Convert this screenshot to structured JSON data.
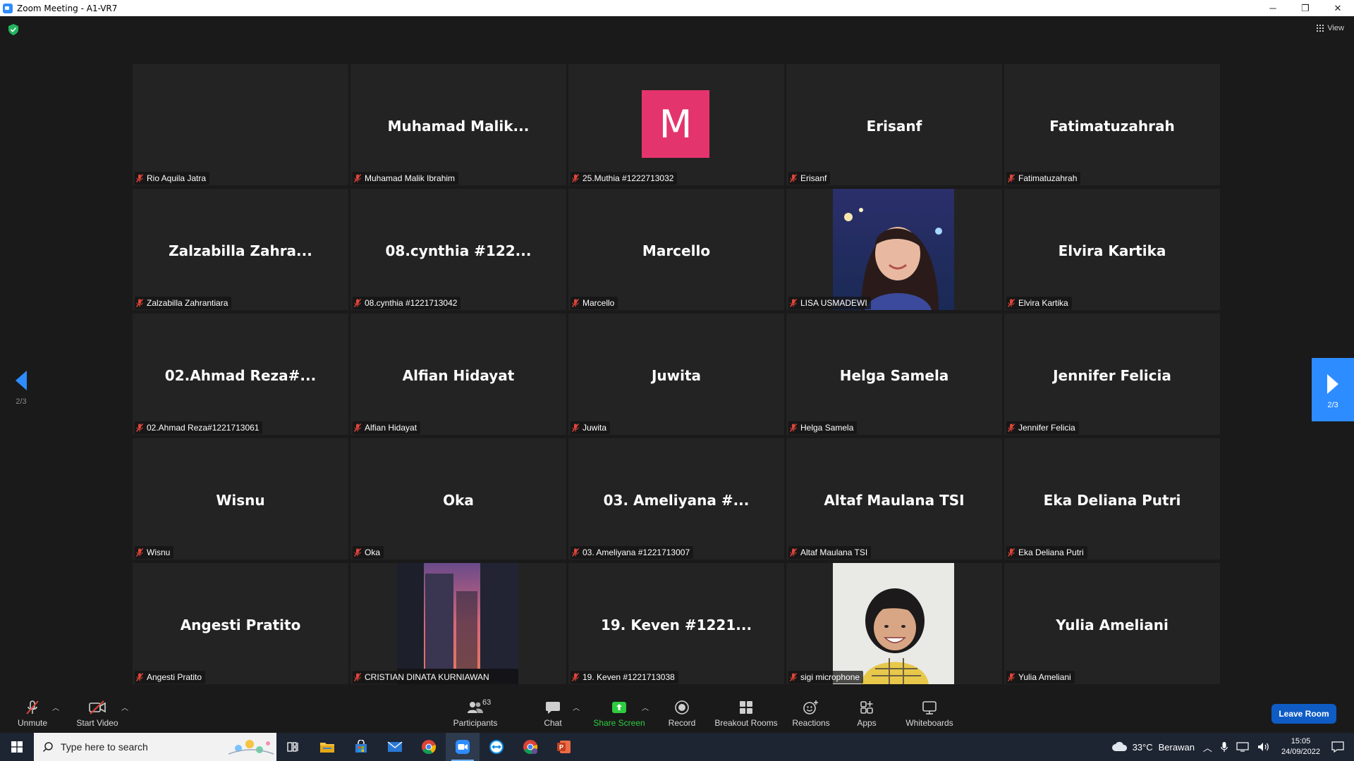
{
  "window": {
    "title": "Zoom Meeting - A1-VR7",
    "minimize": "─",
    "maximize": "❐",
    "close": "✕"
  },
  "top": {
    "view_label": "View"
  },
  "pager": {
    "left_page": "2/3",
    "right_page": "2/3"
  },
  "tiles": [
    {
      "big": "",
      "label": "Rio Aquila Jatra"
    },
    {
      "big": "Muhamad  Malik...",
      "label": "Muhamad Malik Ibrahim"
    },
    {
      "big": "",
      "label": "25.Muthia #1222713032",
      "avatar": "M"
    },
    {
      "big": "Erisanf",
      "label": "Erisanf"
    },
    {
      "big": "Fatimatuzahrah",
      "label": "Fatimatuzahrah"
    },
    {
      "big": "Zalzabilla  Zahra...",
      "label": "Zalzabilla Zahrantiara"
    },
    {
      "big": "08.cynthia #122...",
      "label": "08.cynthia #1221713042"
    },
    {
      "big": "Marcello",
      "label": "Marcello"
    },
    {
      "big": "",
      "label": "LISA USMADEWI"
    },
    {
      "big": "Elvira Kartika",
      "label": "Elvira Kartika"
    },
    {
      "big": "02.Ahmad  Reza#...",
      "label": "02.Ahmad Reza#1221713061"
    },
    {
      "big": "Alfian Hidayat",
      "label": "Alfian Hidayat"
    },
    {
      "big": "Juwita",
      "label": "Juwita"
    },
    {
      "big": "Helga Samela",
      "label": "Helga Samela"
    },
    {
      "big": "Jennifer Felicia",
      "label": "Jennifer Felicia"
    },
    {
      "big": "Wisnu",
      "label": "Wisnu"
    },
    {
      "big": "Oka",
      "label": "Oka"
    },
    {
      "big": "03. Ameliyana #...",
      "label": "03. Ameliyana #1221713007"
    },
    {
      "big": "Altaf Maulana TSI",
      "label": "Altaf Maulana TSI"
    },
    {
      "big": "Eka Deliana Putri",
      "label": "Eka Deliana Putri"
    },
    {
      "big": "Angesti Pratito",
      "label": "Angesti Pratito"
    },
    {
      "big": "",
      "label": "CRISTIAN DINATA KURNIAWAN"
    },
    {
      "big": "19. Keven #1221...",
      "label": "19. Keven #1221713038"
    },
    {
      "big": "",
      "label": "sigi microphone"
    },
    {
      "big": "Yulia Ameliani",
      "label": "Yulia Ameliani"
    }
  ],
  "toolbar": {
    "unmute": "Unmute",
    "start_video": "Start Video",
    "participants": "Participants",
    "participants_count": "63",
    "chat": "Chat",
    "share_screen": "Share Screen",
    "record": "Record",
    "breakout_rooms": "Breakout Rooms",
    "reactions": "Reactions",
    "apps": "Apps",
    "whiteboards": "Whiteboards",
    "leave_room": "Leave Room",
    "share_color": "#2ecc40"
  },
  "taskbar": {
    "search_placeholder": "Type here to search",
    "weather_temp": "33°C",
    "weather_text": "Berawan",
    "time": "15:05",
    "date": "24/09/2022"
  }
}
